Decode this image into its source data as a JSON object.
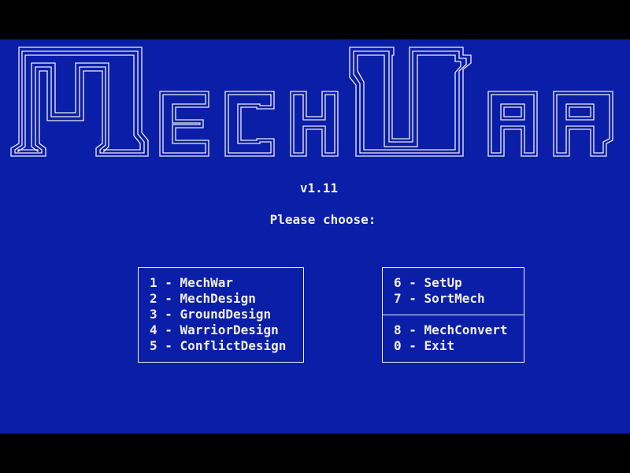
{
  "colors": {
    "screen_background": "#0a1ea8",
    "letterbox": "#000000",
    "text": "#f0f0f0"
  },
  "logo": {
    "text": "MechWar"
  },
  "version": "v1.11",
  "prompt": "Please choose:",
  "menu": {
    "left": [
      {
        "key": "1",
        "sep": " - ",
        "label": "MechWar"
      },
      {
        "key": "2",
        "sep": " - ",
        "label": "MechDesign"
      },
      {
        "key": "3",
        "sep": " - ",
        "label": "GroundDesign"
      },
      {
        "key": "4",
        "sep": " - ",
        "label": "WarriorDesign"
      },
      {
        "key": "5",
        "sep": " - ",
        "label": "ConflictDesign"
      }
    ],
    "right_top": [
      {
        "key": "6",
        "sep": " - ",
        "label": "SetUp"
      },
      {
        "key": "7",
        "sep": " - ",
        "label": "SortMech"
      }
    ],
    "right_bottom": [
      {
        "key": "8",
        "sep": " - ",
        "label": "MechConvert"
      },
      {
        "key": "0",
        "sep": " - ",
        "label": "Exit"
      }
    ]
  }
}
